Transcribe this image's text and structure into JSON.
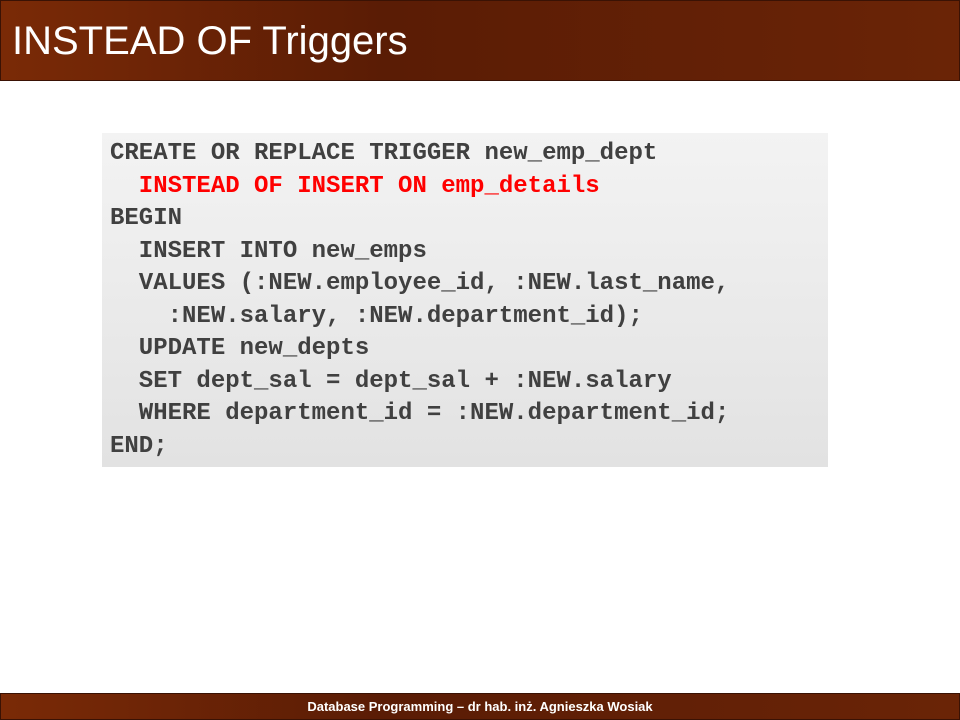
{
  "slide": {
    "title": "INSTEAD OF Triggers",
    "footer": "Database Programming – dr hab. inż. Agnieszka Wosiak"
  },
  "code": {
    "lines": [
      {
        "text": "CREATE OR REPLACE TRIGGER new_emp_dept",
        "highlight": false
      },
      {
        "text": "  INSTEAD OF INSERT ON emp_details",
        "highlight": true
      },
      {
        "text": "BEGIN",
        "highlight": false
      },
      {
        "text": "  INSERT INTO new_emps",
        "highlight": false
      },
      {
        "text": "  VALUES (:NEW.employee_id, :NEW.last_name,",
        "highlight": false
      },
      {
        "text": "    :NEW.salary, :NEW.department_id);",
        "highlight": false
      },
      {
        "text": "  UPDATE new_depts",
        "highlight": false
      },
      {
        "text": "  SET dept_sal = dept_sal + :NEW.salary",
        "highlight": false
      },
      {
        "text": "  WHERE department_id = :NEW.department_id;",
        "highlight": false
      },
      {
        "text": "END;",
        "highlight": false
      }
    ],
    "highlight_color": "#ff0000",
    "text_color": "#404040"
  },
  "colors": {
    "bar_dark": "#5a1c05",
    "bar_light": "#7a2a06"
  }
}
